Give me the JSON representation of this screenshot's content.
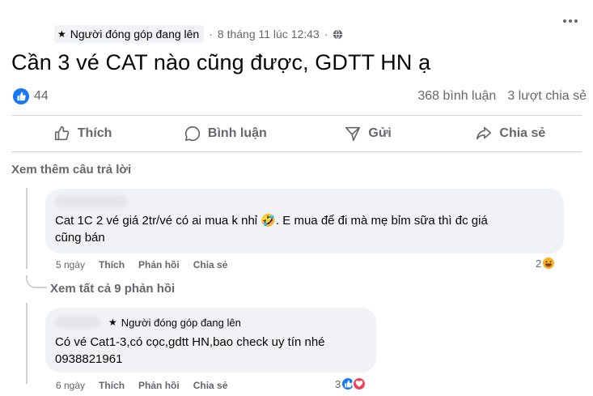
{
  "post": {
    "badge": "Người đóng góp đang lên",
    "timestamp": "8 tháng 11 lúc 12:43",
    "separator": "·",
    "title": "Cần 3 vé CAT nào cũng được, GDTT HN ạ",
    "reaction_count": "44",
    "comments_count": "368 bình luận",
    "shares_count": "3 lượt chia sẻ"
  },
  "actions": {
    "like": "Thích",
    "comment": "Bình luận",
    "send": "Gửi",
    "share": "Chia sẻ"
  },
  "view_more_replies": "Xem thêm câu trả lời",
  "comments": [
    {
      "text_line1": "Cat 1C 2 vé giá 2tr/vé có ai mua k nhỉ 🤣. E mua để đi mà mẹ bỉm sữa thì đc giá",
      "text_line2": "cũng bán",
      "age": "5 ngày",
      "like": "Thích",
      "reply": "Phản hồi",
      "share": "Chia sẻ",
      "reaction_count": "2"
    },
    {
      "badge": "Người đóng góp đang lên",
      "text_line1": "Có vé Cat1-3,có cọc,gdtt HN,bao check uy tín nhé",
      "text_line2": "0938821961",
      "age": "6 ngày",
      "like": "Thích",
      "reply": "Phản hồi",
      "share": "Chia sẻ",
      "reaction_count": "3"
    }
  ],
  "see_all_replies": "Xem tất cả 9 phản hồi",
  "colors": {
    "primary": "#1877f2",
    "secondary_text": "#65676b",
    "bubble_bg": "#f0f2f5",
    "divider": "#ced0d4"
  },
  "icons": [
    "star-icon",
    "globe-icon",
    "more-icon",
    "like-icon",
    "comment-icon",
    "send-icon",
    "share-icon",
    "haha-emoji-icon",
    "love-icon"
  ]
}
